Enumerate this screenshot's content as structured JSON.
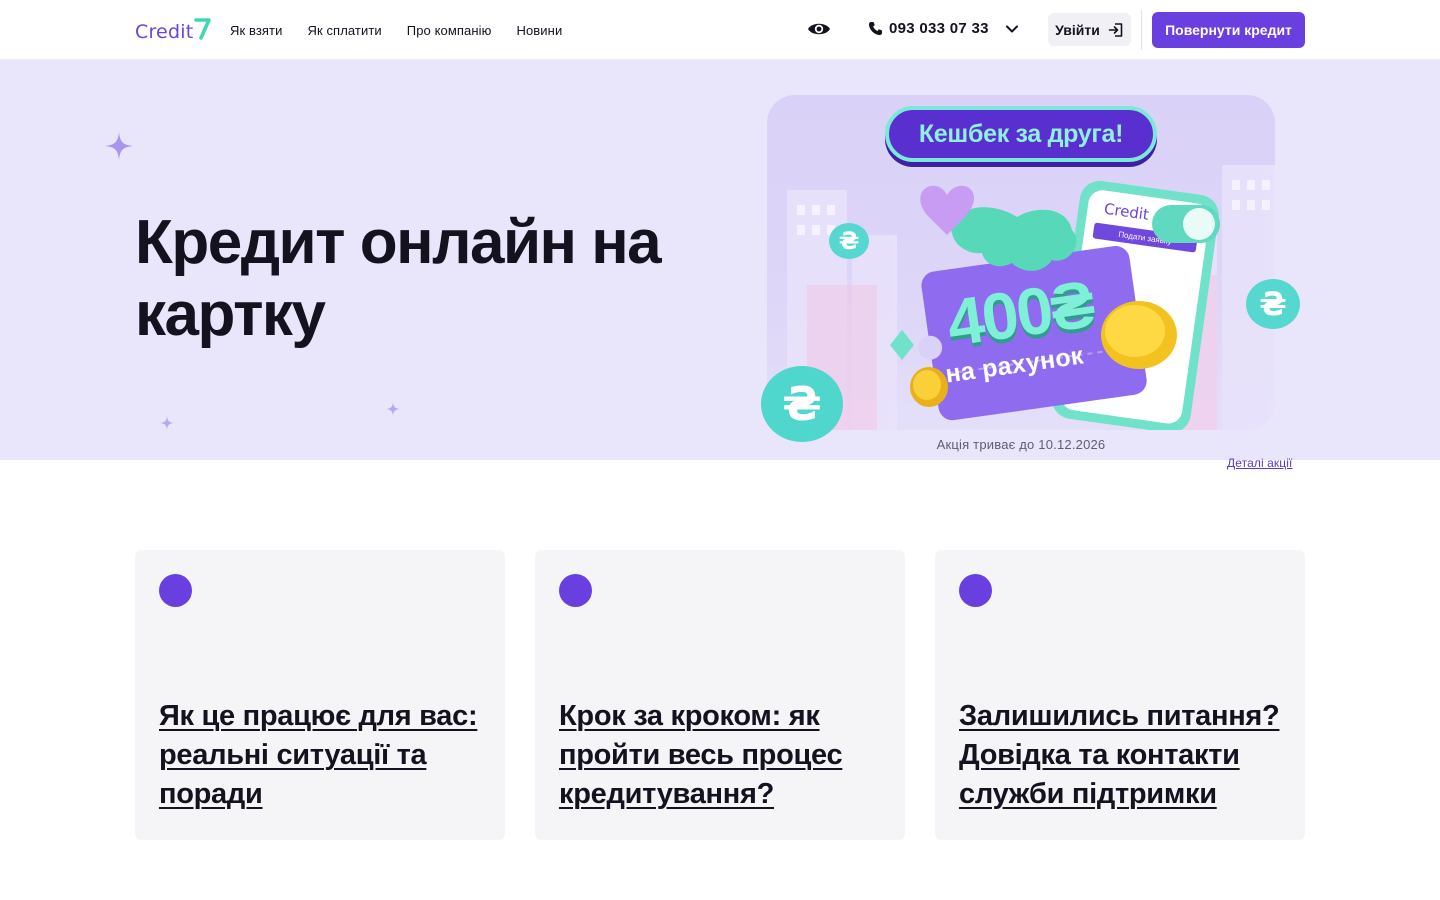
{
  "header": {
    "logo_text": "Credit",
    "logo_digit": "7",
    "nav": [
      {
        "label": "Як взяти"
      },
      {
        "label": "Як сплатити"
      },
      {
        "label": "Про компанію"
      },
      {
        "label": "Новини"
      }
    ],
    "phone": "093 033 07 33",
    "login_label": "Увійти",
    "return_label": "Повернути кредит",
    "icons": {
      "accessibility": "eye-icon",
      "phone": "phone-icon",
      "dropdown": "chevron-down-icon",
      "login": "login-icon"
    }
  },
  "hero": {
    "title": "Кредит онлайн на картку",
    "promo": {
      "headline": "Кешбек за друга!",
      "amount": "400₴",
      "amount_caption": "на рахунок",
      "phone_logo": "Credit",
      "phone_button": "Подати заявку",
      "duration_note": "Акція триває до 10.12.2026",
      "details_link": "Деталі акції"
    }
  },
  "cards": [
    {
      "title": "Як це працює для вас: реальні ситуації та поради"
    },
    {
      "title": "Крок за кроком: як пройти весь процес кредитування?"
    },
    {
      "title": "Залишились питання? Довідка та контакти служби підтримки"
    }
  ],
  "colors": {
    "brand": "#6a3fe0",
    "hero_bg": "#e9e5fb",
    "mint": "#7ff0d7",
    "card_bg": "#f5f5f8"
  }
}
